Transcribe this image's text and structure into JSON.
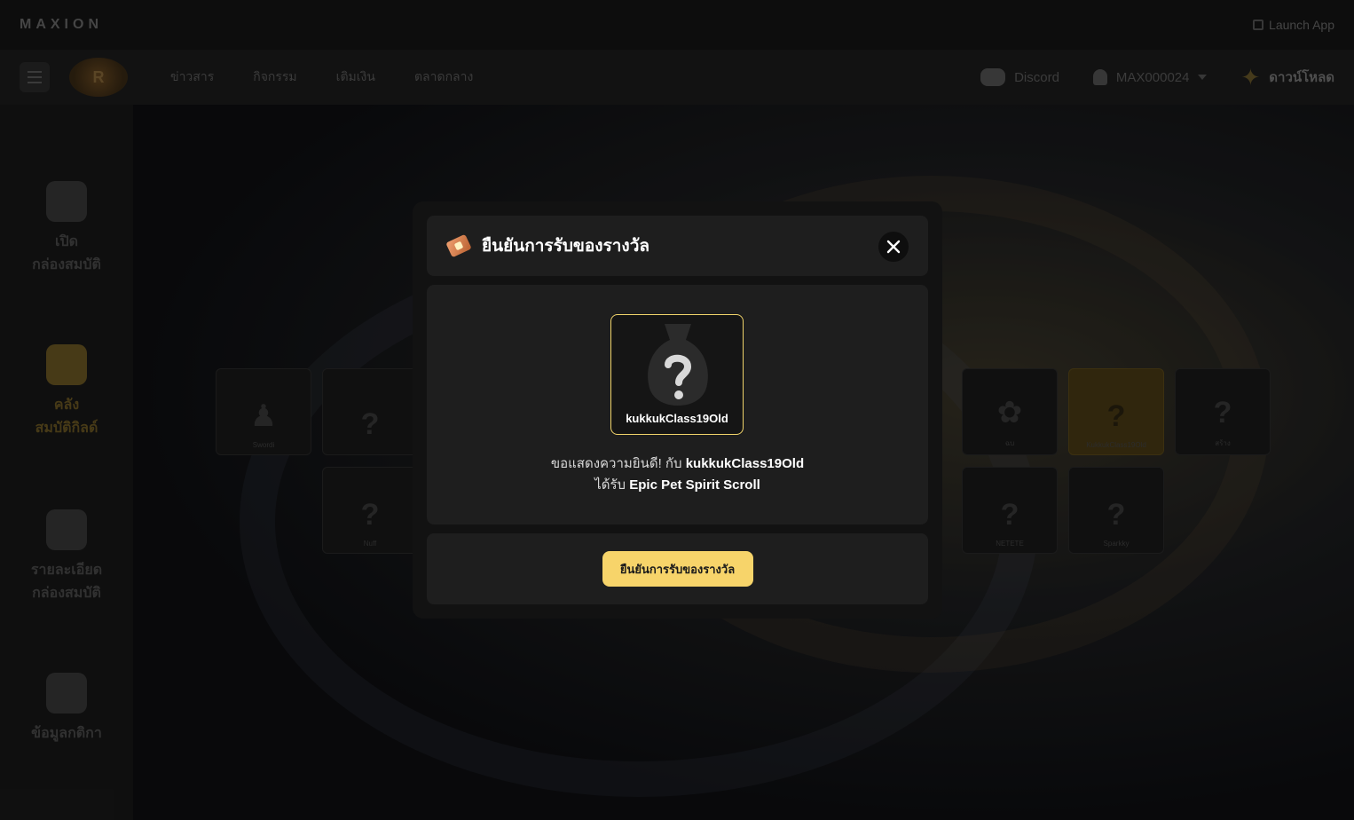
{
  "brand": {
    "name": "MAXION",
    "launch_label": "Launch App"
  },
  "nav": {
    "links": [
      "ข่าวสาร",
      "กิจกรรม",
      "เติมเงิน",
      "ตลาดกลาง"
    ],
    "discord_label": "Discord",
    "username": "MAX000024",
    "download_label": "ดาวน์โหลด"
  },
  "sidebar": {
    "items": [
      {
        "label": "เปิด\nกล่องสมบัติ",
        "icon": "key-icon"
      },
      {
        "label": "คลัง\nสมบัติกิลด์",
        "icon": "money-bag-icon"
      },
      {
        "label": "รายละเอียด\nกล่องสมบัติ",
        "icon": "list-icon"
      },
      {
        "label": "ข้อมูลกติกา",
        "icon": "shield-icon"
      }
    ]
  },
  "background_cards": [
    "Swordi",
    "ฉบ",
    "Nuff",
    "NETETE",
    "Sparkky",
    "KukkukClass19Old",
    "สร้าง"
  ],
  "modal": {
    "title": "ยืนยันการรับของรางวัล",
    "reward_name": "kukkukClass19Old",
    "congrats_prefix": "ขอแสดงความยินดี! กับ",
    "congrats_name": "kukkukClass19Old",
    "received_prefix": "ได้รับ",
    "item_name": "Epic Pet Spirit Scroll",
    "confirm_label": "ยืนยันการรับของรางวัล"
  },
  "colors": {
    "accent": "#f7d46a",
    "card_border": "#f1d46b",
    "modal_bg": "#121212",
    "panel_bg": "#1e1e1e"
  }
}
